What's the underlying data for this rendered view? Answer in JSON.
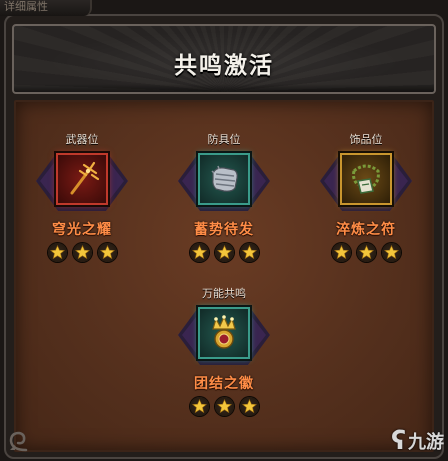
{
  "top_tab": {
    "label": "详细属性"
  },
  "header": {
    "title": "共鸣激活"
  },
  "slots": [
    {
      "label": "武器位",
      "name": "穹光之耀",
      "stars": 3,
      "item_icon": "trident-icon",
      "frame": "red"
    },
    {
      "label": "防具位",
      "name": "蓄势待发",
      "stars": 3,
      "item_icon": "gauntlet-icon",
      "frame": "teal"
    },
    {
      "label": "饰品位",
      "name": "淬炼之符",
      "stars": 3,
      "item_icon": "amulet-necklace-icon",
      "frame": "gold"
    },
    {
      "label": "万能共鸣",
      "name": "团结之徽",
      "stars": 3,
      "item_icon": "crown-emblem-icon",
      "frame": "teal"
    }
  ],
  "watermark": {
    "text": "九游",
    "icon": "jiuyou-logo-icon"
  },
  "colors": {
    "name_text": "#ff8d47",
    "board": "#55301d",
    "star": "#f3c63b"
  }
}
